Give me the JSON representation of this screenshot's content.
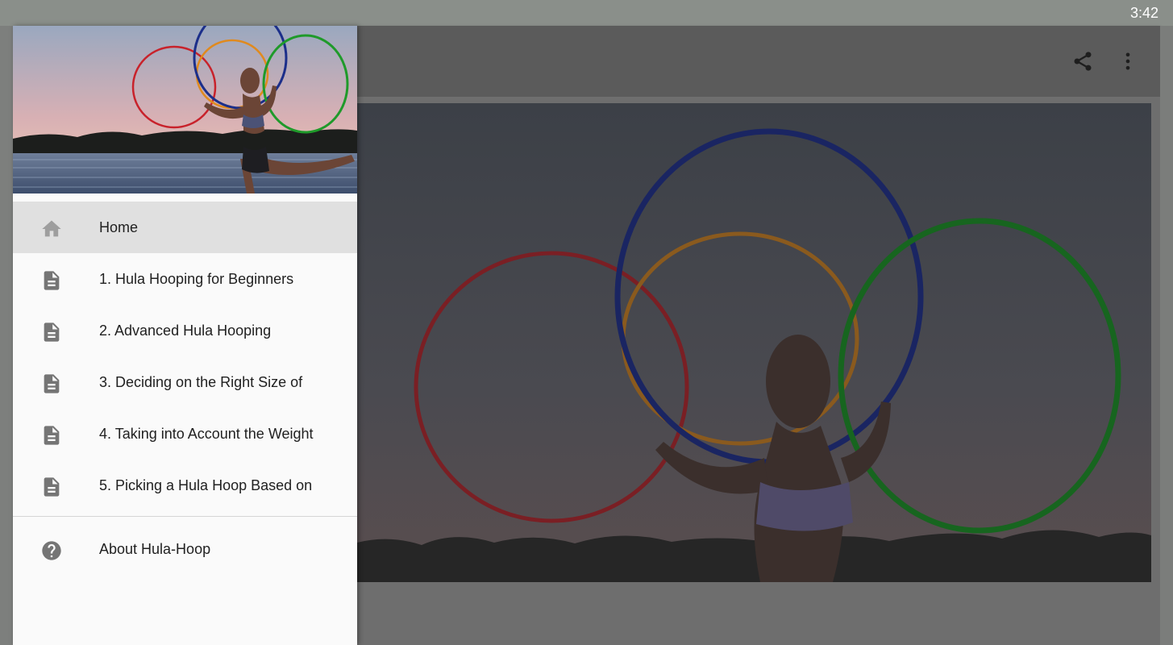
{
  "status_bar": {
    "time": "3:42"
  },
  "app_bar": {
    "actions": [
      {
        "icon": "share-icon"
      },
      {
        "icon": "more-vert-icon"
      }
    ]
  },
  "drawer": {
    "items": [
      {
        "label": "Home",
        "icon": "home-icon",
        "selected": true
      },
      {
        "label": "1. Hula Hooping for Beginners",
        "icon": "document-icon"
      },
      {
        "label": "2. Advanced Hula Hooping",
        "icon": "document-icon"
      },
      {
        "label": "3. Deciding on the Right Size of",
        "icon": "document-icon"
      },
      {
        "label": "4. Taking into Account the Weight",
        "icon": "document-icon"
      },
      {
        "label": "5. Picking a Hula Hoop Based on",
        "icon": "document-icon"
      }
    ],
    "footer_items": [
      {
        "label": "About Hula-Hoop",
        "icon": "help-circle-icon"
      }
    ]
  },
  "colors": {
    "hoop_red": "#c8222b",
    "hoop_blue": "#1c2f8a",
    "hoop_orange": "#e08a1e",
    "hoop_green": "#1f9a2a",
    "drawer_bg": "#fafafa",
    "selected_bg": "#e0e0e0",
    "icon_gray": "#757575"
  }
}
